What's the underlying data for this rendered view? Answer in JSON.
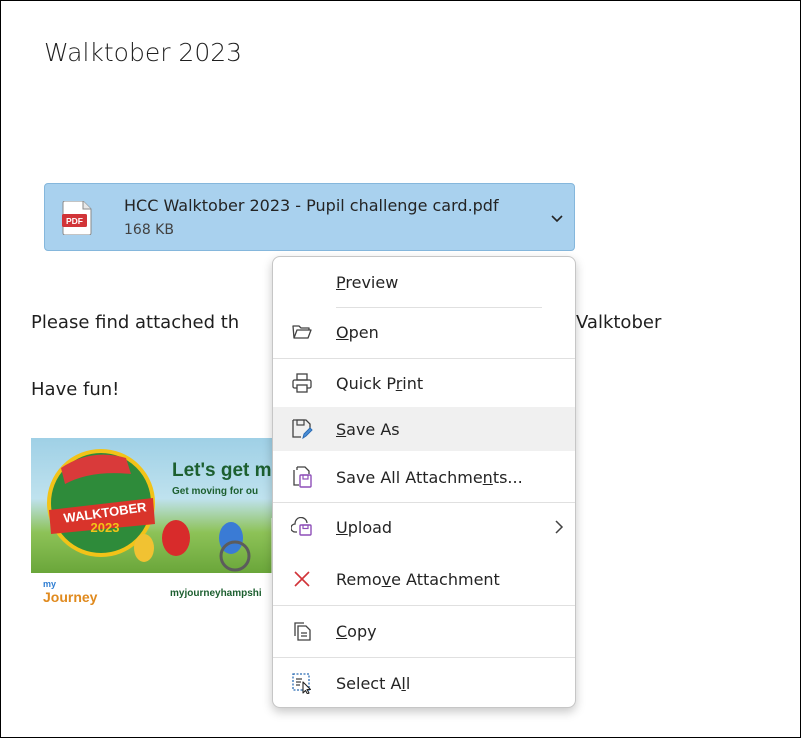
{
  "email": {
    "subject": "Walktober 2023",
    "body_line1": "Please find attached th",
    "body_line1_tail": "Valktober",
    "body_line2": "Have fun!"
  },
  "attachment": {
    "icon": "pdf-file-icon",
    "icon_text": "PDF",
    "name": "HCC Walktober 2023 - Pupil challenge card.pdf",
    "size": "168 KB",
    "accent_color": "#a9d1ee"
  },
  "banner": {
    "heading": "Let's get m",
    "subheading": "Get moving for ou",
    "badge_line1": "WALKTOBER",
    "badge_line2": "2023",
    "brand_line1": "my",
    "brand_line2": "Journey",
    "url": "myjourneyhampshi"
  },
  "context_menu": {
    "items": [
      {
        "label_pre": "",
        "label_u": "P",
        "label_post": "review",
        "icon": "none"
      },
      {
        "label_pre": "",
        "label_u": "O",
        "label_post": "pen",
        "icon": "folder-open-icon"
      },
      {
        "label_pre": "Quick P",
        "label_u": "r",
        "label_post": "int",
        "icon": "printer-icon"
      },
      {
        "label_pre": "",
        "label_u": "S",
        "label_post": "ave As",
        "icon": "save-as-icon"
      },
      {
        "label_pre": "Save All Attachme",
        "label_u": "n",
        "label_post": "ts...",
        "icon": "save-all-icon"
      },
      {
        "label_pre": "",
        "label_u": "U",
        "label_post": "pload",
        "icon": "upload-icon"
      },
      {
        "label_pre": "Remo",
        "label_u": "v",
        "label_post": "e Attachment",
        "icon": "remove-icon"
      },
      {
        "label_pre": "",
        "label_u": "C",
        "label_post": "opy",
        "icon": "copy-icon"
      },
      {
        "label_pre": "Select A",
        "label_u": "l",
        "label_post": "l",
        "icon": "select-all-icon"
      }
    ]
  }
}
